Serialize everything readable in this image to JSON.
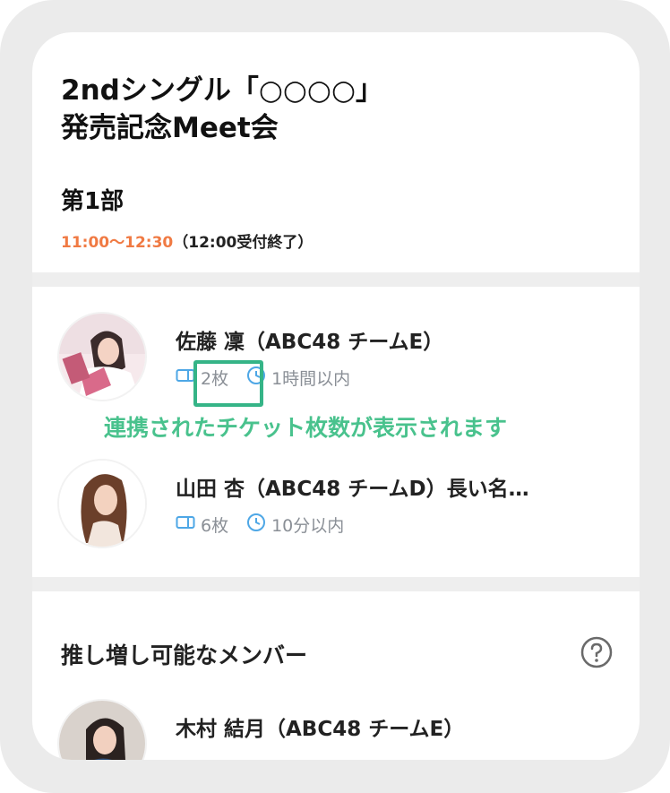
{
  "event": {
    "title_line1": "2ndシングル「○○○○」",
    "title_line2": "発売記念Meet会",
    "part_title": "第1部",
    "time_range": "11:00～12:30",
    "time_note": "（12:00受付終了）"
  },
  "members": [
    {
      "name": "佐藤 凜（ABC48 チームE）",
      "tickets": "2枚",
      "time_limit": "1時間以内"
    },
    {
      "name": "山田 杏（ABC48 チームD）長い名…",
      "tickets": "6枚",
      "time_limit": "10分以内"
    }
  ],
  "annotation": "連携されたチケット枚数が表示されます",
  "boost": {
    "title": "推し増し可能なメンバー",
    "members": [
      {
        "name": "木村 結月（ABC48 チームE）"
      }
    ]
  },
  "colors": {
    "accent_orange": "#f07a43",
    "icon_blue": "#4ea7e6",
    "annotation_green": "#49c28d"
  },
  "icons": {
    "ticket": "ticket-icon",
    "clock": "clock-icon",
    "help": "help-circle-icon"
  }
}
